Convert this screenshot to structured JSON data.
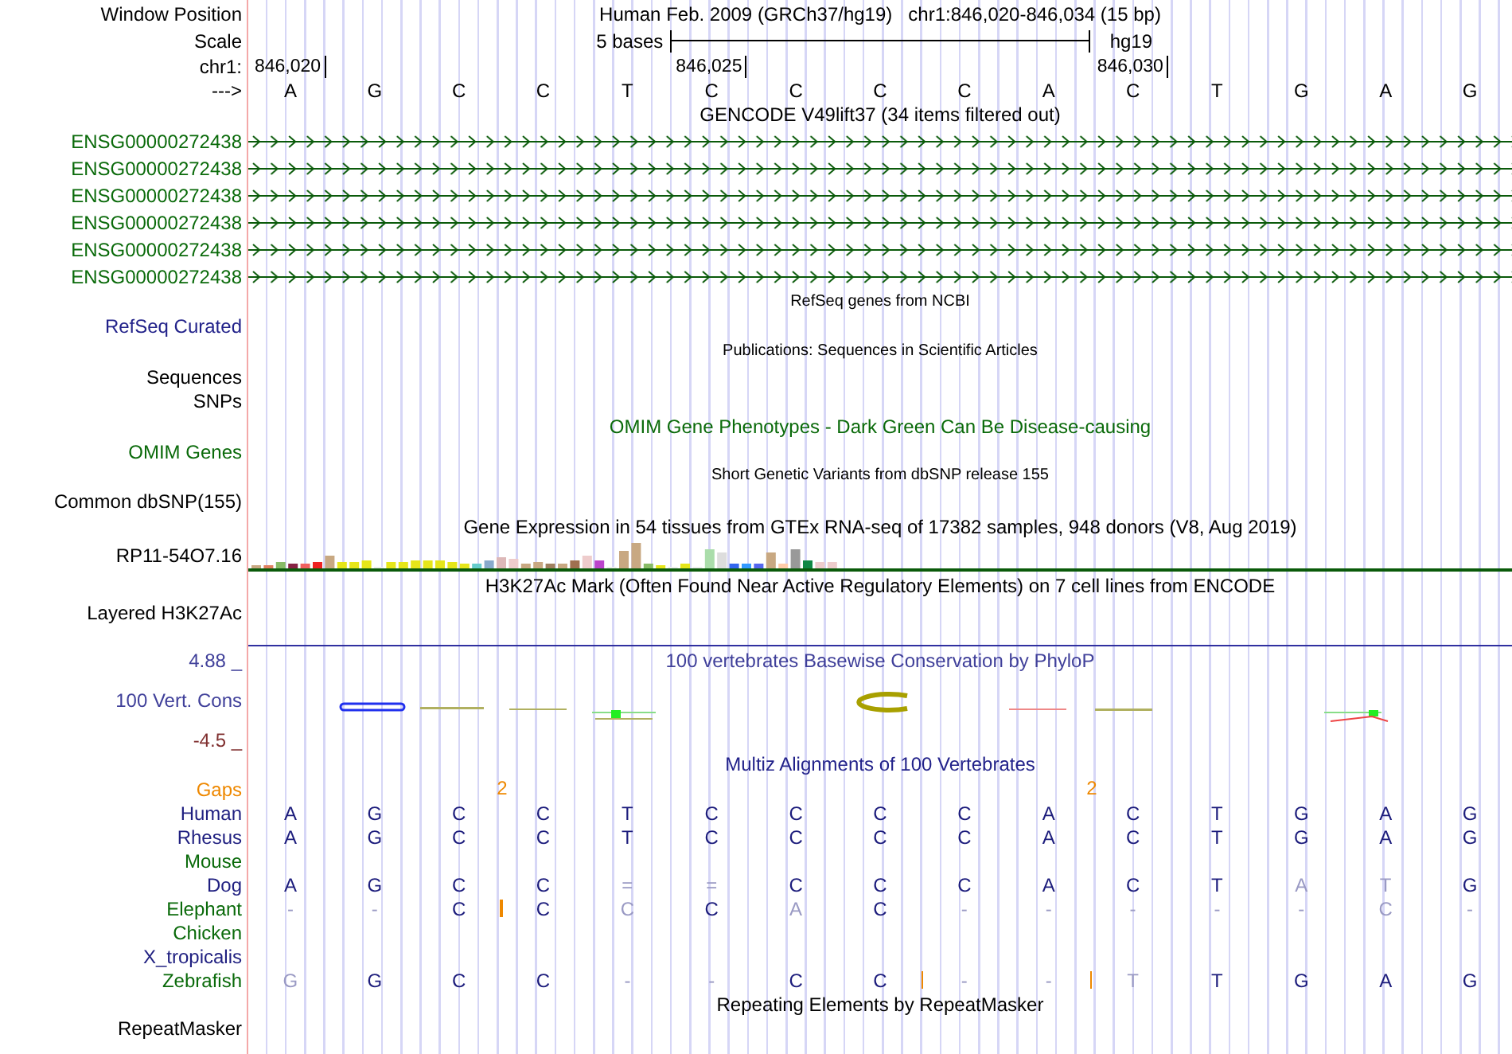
{
  "header": {
    "label": "Window Position",
    "assembly": "Human Feb. 2009 (GRCh37/hg19)",
    "position": "chr1:846,020-846,034 (15 bp)"
  },
  "scale": {
    "label": "Scale",
    "length": "5 bases",
    "db": "hg19"
  },
  "ruler": {
    "label": "chr1:",
    "ticks": [
      "846,020",
      "846,025",
      "846,030"
    ]
  },
  "sequence": {
    "label": "--->",
    "bases": [
      "A",
      "G",
      "C",
      "C",
      "T",
      "C",
      "C",
      "C",
      "C",
      "A",
      "C",
      "T",
      "G",
      "A",
      "G"
    ]
  },
  "gencode": {
    "title": "GENCODE V49lift37 (34 items filtered out)",
    "genes": [
      "ENSG00000272438",
      "ENSG00000272438",
      "ENSG00000272438",
      "ENSG00000272438",
      "ENSG00000272438",
      "ENSG00000272438"
    ]
  },
  "refseq": {
    "title": "RefSeq genes from NCBI",
    "label": "RefSeq Curated"
  },
  "publications": {
    "title": "Publications: Sequences in Scientific Articles",
    "labels": [
      "Sequences",
      "SNPs"
    ]
  },
  "omim": {
    "title": "OMIM Gene Phenotypes - Dark Green Can Be Disease-causing",
    "label": "OMIM Genes"
  },
  "dbsnp": {
    "title": "Short Genetic Variants from dbSNP release 155",
    "label": "Common dbSNP(155)"
  },
  "gtex": {
    "title": "Gene Expression in 54 tissues from GTEx RNA-seq of 17382 samples, 948 donors (V8, Aug 2019)",
    "label": "RP11-54O7.16"
  },
  "h3k27ac": {
    "title": "H3K27Ac Mark (Often Found Near Active Regulatory Elements) on 7 cell lines from ENCODE",
    "label": "Layered H3K27Ac"
  },
  "phylop": {
    "title": "100 vertebrates Basewise Conservation by PhyloP",
    "label": "100 Vert. Cons",
    "max": "4.88 _",
    "min": "-4.5 _"
  },
  "multiz": {
    "title": "Multiz Alignments of 100 Vertebrates",
    "gaps": {
      "label": "Gaps"
    },
    "species": [
      {
        "name": "Human",
        "color": "#1f1f80",
        "bases": [
          {
            "text": "A",
            "faded": false,
            "insert_after": false
          },
          {
            "text": "G",
            "faded": false,
            "insert_after": false
          },
          {
            "text": "C",
            "faded": false,
            "insert_after": false,
            "gap_count": "2"
          },
          {
            "text": "C",
            "faded": false,
            "insert_after": false
          },
          {
            "text": "T",
            "faded": false,
            "insert_after": false
          },
          {
            "text": "C",
            "faded": false,
            "insert_after": false
          },
          {
            "text": "C",
            "faded": false,
            "insert_after": false
          },
          {
            "text": "C",
            "faded": false,
            "insert_after": false
          },
          {
            "text": "C",
            "faded": false,
            "insert_after": false
          },
          {
            "text": "A",
            "faded": false,
            "insert_after": false,
            "gap_count": "2"
          },
          {
            "text": "C",
            "faded": false,
            "insert_after": false
          },
          {
            "text": "T",
            "faded": false,
            "insert_after": false
          },
          {
            "text": "G",
            "faded": false,
            "insert_after": false
          },
          {
            "text": "A",
            "faded": false,
            "insert_after": false
          },
          {
            "text": "G",
            "faded": false,
            "insert_after": false
          }
        ]
      },
      {
        "name": "Rhesus",
        "color": "#1f1f80",
        "bases": [
          {
            "text": "A",
            "faded": false,
            "insert_after": false
          },
          {
            "text": "G",
            "faded": false,
            "insert_after": false
          },
          {
            "text": "C",
            "faded": false,
            "insert_after": false
          },
          {
            "text": "C",
            "faded": false,
            "insert_after": false
          },
          {
            "text": "T",
            "faded": false,
            "insert_after": false
          },
          {
            "text": "C",
            "faded": false,
            "insert_after": false
          },
          {
            "text": "C",
            "faded": false,
            "insert_after": false
          },
          {
            "text": "C",
            "faded": false,
            "insert_after": false
          },
          {
            "text": "C",
            "faded": false,
            "insert_after": false
          },
          {
            "text": "A",
            "faded": false,
            "insert_after": false
          },
          {
            "text": "C",
            "faded": false,
            "insert_after": false
          },
          {
            "text": "T",
            "faded": false,
            "insert_after": false
          },
          {
            "text": "G",
            "faded": false,
            "insert_after": false
          },
          {
            "text": "A",
            "faded": false,
            "insert_after": false
          },
          {
            "text": "G",
            "faded": false,
            "insert_after": false
          }
        ]
      },
      {
        "name": "Mouse",
        "color": "#0a6a0a"
      },
      {
        "name": "Dog",
        "color": "#1f1f80",
        "bases": [
          {
            "text": "A",
            "faded": false,
            "insert_after": false
          },
          {
            "text": "G",
            "faded": false,
            "insert_after": false
          },
          {
            "text": "C",
            "faded": false,
            "insert_after": false
          },
          {
            "text": "C",
            "faded": false,
            "insert_after": false
          },
          {
            "text": "=",
            "faded": true,
            "insert_after": false
          },
          {
            "text": "=",
            "faded": true,
            "insert_after": false
          },
          {
            "text": "C",
            "faded": false,
            "insert_after": false
          },
          {
            "text": "C",
            "faded": false,
            "insert_after": false
          },
          {
            "text": "C",
            "faded": false,
            "insert_after": false
          },
          {
            "text": "A",
            "faded": false,
            "insert_after": false
          },
          {
            "text": "C",
            "faded": false,
            "insert_after": false
          },
          {
            "text": "T",
            "faded": false,
            "insert_after": false
          },
          {
            "text": "A",
            "faded": true,
            "insert_after": false
          },
          {
            "text": "T",
            "faded": true,
            "insert_after": false
          },
          {
            "text": "G",
            "faded": false,
            "insert_after": false
          }
        ]
      },
      {
        "name": "Elephant",
        "color": "#0a6a0a",
        "bases": [
          {
            "text": "-",
            "faded": true,
            "insert_after": false
          },
          {
            "text": "-",
            "faded": true,
            "insert_after": false
          },
          {
            "text": "C",
            "faded": false,
            "insert_after": true
          },
          {
            "text": "C",
            "faded": false,
            "insert_after": false
          },
          {
            "text": "C",
            "faded": true,
            "insert_after": false
          },
          {
            "text": "C",
            "faded": false,
            "insert_after": false
          },
          {
            "text": "A",
            "faded": true,
            "insert_after": false
          },
          {
            "text": "C",
            "faded": false,
            "insert_after": false
          },
          {
            "text": "-",
            "faded": true,
            "insert_after": false
          },
          {
            "text": "-",
            "faded": true,
            "insert_after": false
          },
          {
            "text": "-",
            "faded": true,
            "insert_after": false
          },
          {
            "text": "-",
            "faded": true,
            "insert_after": false
          },
          {
            "text": "-",
            "faded": true,
            "insert_after": false
          },
          {
            "text": "C",
            "faded": true,
            "insert_after": false
          },
          {
            "text": "-",
            "faded": true,
            "insert_after": false
          }
        ]
      },
      {
        "name": "Chicken",
        "color": "#0a6a0a"
      },
      {
        "name": "X_tropicalis",
        "color": "#1f1f80"
      },
      {
        "name": "Zebrafish",
        "color": "#0a6a0a",
        "bases": [
          {
            "text": "G",
            "faded": true,
            "insert_after": false
          },
          {
            "text": "G",
            "faded": false,
            "insert_after": false
          },
          {
            "text": "C",
            "faded": false,
            "insert_after": false
          },
          {
            "text": "C",
            "faded": false,
            "insert_after": false
          },
          {
            "text": "-",
            "faded": true,
            "insert_after": false
          },
          {
            "text": "-",
            "faded": true,
            "insert_after": false
          },
          {
            "text": "C",
            "faded": false,
            "insert_after": false
          },
          {
            "text": "C",
            "faded": false,
            "insert_after": true
          },
          {
            "text": "-",
            "faded": true,
            "insert_after": false
          },
          {
            "text": "-",
            "faded": true,
            "insert_after": true
          },
          {
            "text": "T",
            "faded": true,
            "insert_after": false
          },
          {
            "text": "T",
            "faded": false,
            "insert_after": false
          },
          {
            "text": "G",
            "faded": false,
            "insert_after": false
          },
          {
            "text": "A",
            "faded": false,
            "insert_after": false
          },
          {
            "text": "G",
            "faded": false,
            "insert_after": false
          }
        ]
      }
    ]
  },
  "repeatmasker": {
    "title": "Repeating Elements by RepeatMasker",
    "label": "RepeatMasker"
  }
}
